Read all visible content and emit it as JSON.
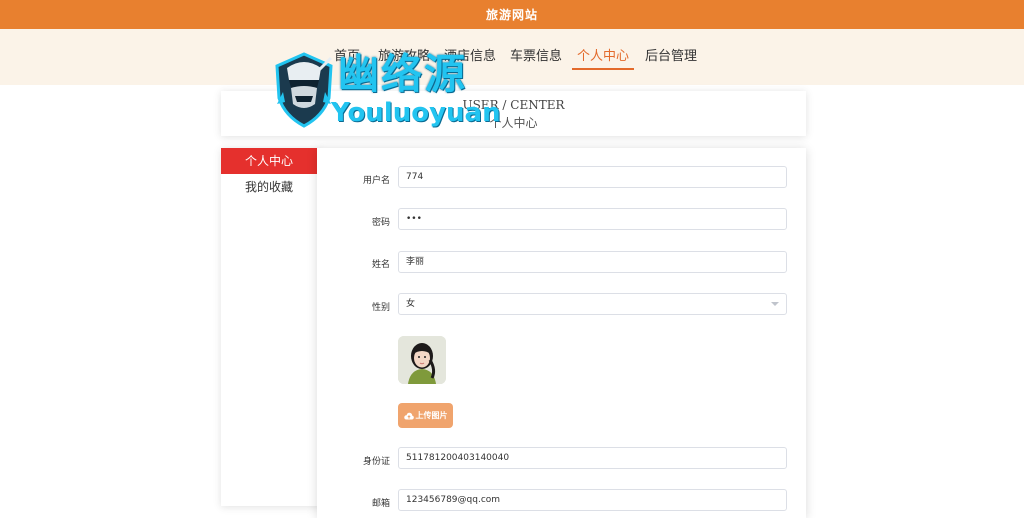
{
  "site": {
    "title": "旅游网站"
  },
  "nav": {
    "items": [
      {
        "label": "首页"
      },
      {
        "label": "旅游攻略"
      },
      {
        "label": "酒店信息"
      },
      {
        "label": "车票信息"
      },
      {
        "label": "个人中心"
      },
      {
        "label": "后台管理"
      }
    ],
    "active": "个人中心"
  },
  "watermark": {
    "text_cn": "幽络源",
    "text_en": "Youluoyuan"
  },
  "header": {
    "title_en": "USER / CENTER",
    "title_cn": "个人中心"
  },
  "sidebar": {
    "items": [
      {
        "label": "个人中心"
      },
      {
        "label": "我的收藏"
      }
    ]
  },
  "form": {
    "username": {
      "label": "用户名",
      "value": "774"
    },
    "password": {
      "label": "密码",
      "value": "•••"
    },
    "name": {
      "label": "姓名",
      "value": "李丽"
    },
    "gender": {
      "label": "性别",
      "value": "女"
    },
    "upload": {
      "label": "上传图片"
    },
    "idcard": {
      "label": "身份证",
      "value": "511781200403140040"
    },
    "email": {
      "label": "邮箱",
      "value": "123456789@qq.com"
    }
  },
  "colors": {
    "topbar": "#e8802f",
    "nav_background": "#fbf3e8",
    "nav_active": "#e36a2b",
    "sidebar_active": "#e5302d",
    "upload_button": "#f0a46d",
    "watermark": "#22c4f0"
  },
  "icons": {
    "upload": "cloud-upload-icon",
    "select": "chevron-down-icon",
    "watermark_logo": "ninja-mascot-logo"
  }
}
